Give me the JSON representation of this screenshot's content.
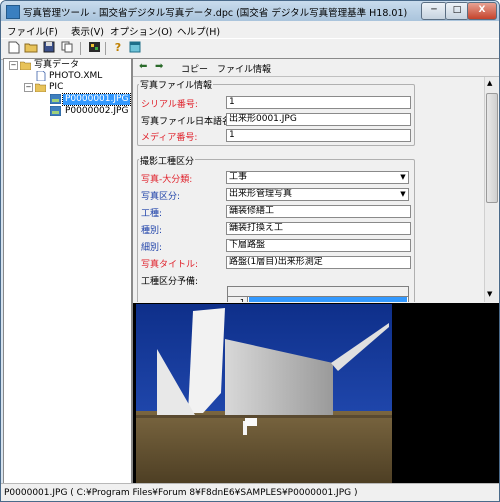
{
  "window": {
    "title": "写真管理ツール - 国交省デジタル写真データ.dpc (国交省 デジタル写真管理基準 H18.01)",
    "min_label": "─",
    "max_label": "□",
    "close_label": "X"
  },
  "menu": {
    "file": "ファイル(F)",
    "view": "表示(V)",
    "options": "オプション(O)",
    "help": "ヘルプ(H)"
  },
  "toolbar": {
    "new_icon": "new-file-icon",
    "open_icon": "open-folder-icon",
    "save_icon": "save-icon",
    "copy_icon": "copy-icon",
    "run_icon": "run-icon",
    "help_icon": "help-icon",
    "window_icon": "window-icon",
    "help_glyph": "?"
  },
  "tree": {
    "root": "写真データ",
    "xml": "PHOTO.XML",
    "pic": "PIC",
    "files": [
      "P0000001.JPG",
      "P0000002.JPG"
    ]
  },
  "nav": {
    "back": "◆",
    "forward": "◆",
    "copy_label": "コピー",
    "file_info_label": "ファイル情報"
  },
  "file_info": {
    "group_label": "写真ファイル情報",
    "serial_label": "シリアル番号:",
    "serial_value": "1",
    "jp_name_label": "写真ファイル日本語名:",
    "jp_name_value": "出来形0001.JPG",
    "media_label": "メディア番号:",
    "media_value": "1"
  },
  "shoot": {
    "group_label": "撮影工種区分",
    "major_label": "写真-大分類:",
    "major_value": "工事",
    "category_label": "写真区分:",
    "category_value": "出来形管理写真",
    "work_type_label": "工種:",
    "work_type_value": "舗装修繕工",
    "kind_label": "種別:",
    "kind_value": "舗装打換え工",
    "detail_label": "細別:",
    "detail_value": "下層路盤",
    "title_label": "写真タイトル:",
    "title_value": "路盤(1層目)出来形測定",
    "reserve_label": "工種区分予備:",
    "reserve_row_num": "1"
  },
  "status": {
    "text": "P0000001.JPG ( C:¥Program Files¥Forum 8¥F8dnE6¥SAMPLES¥P0000001.JPG )"
  },
  "colors": {
    "required_red": "#e0202a",
    "link_blue": "#1b3fa8",
    "selection_blue": "#3399ff"
  }
}
